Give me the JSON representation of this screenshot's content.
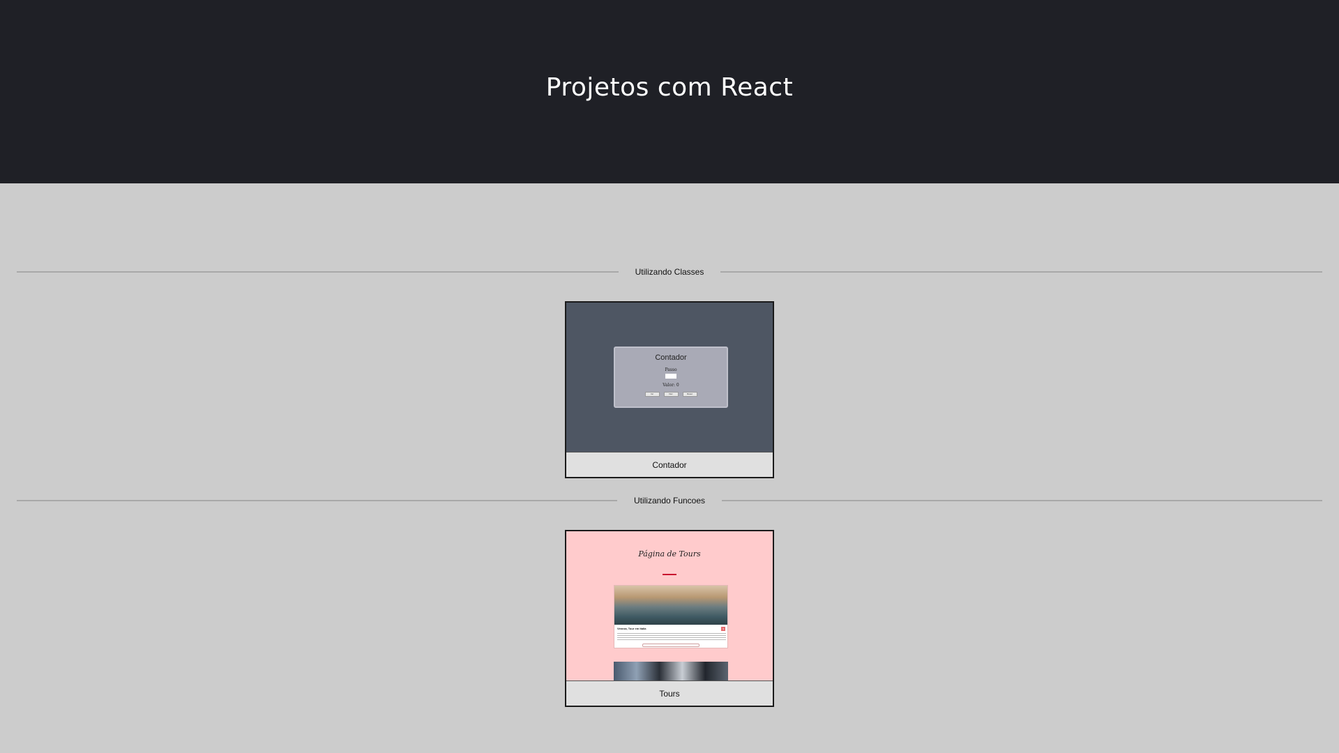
{
  "header": {
    "title": "Projetos com React"
  },
  "sections": [
    {
      "label": "Utilizando Classes",
      "card": {
        "caption": "Contador",
        "preview": {
          "panel_title": "Contador",
          "step_label": "Passo",
          "value_label": "Valor: 0",
          "buttons": [
            "Inc",
            "Dec",
            "Reset"
          ]
        }
      }
    },
    {
      "label": "Utilizando Funcoes",
      "card": {
        "caption": "Tours",
        "preview": {
          "page_title": "Página de Tours",
          "tour_name": "Veneza, Tour em Italia"
        }
      }
    }
  ],
  "colors": {
    "header_bg": "#1f2026",
    "page_bg": "#cccccc",
    "contador_bg": "#4e5663",
    "tours_bg": "#ffcbcc"
  }
}
